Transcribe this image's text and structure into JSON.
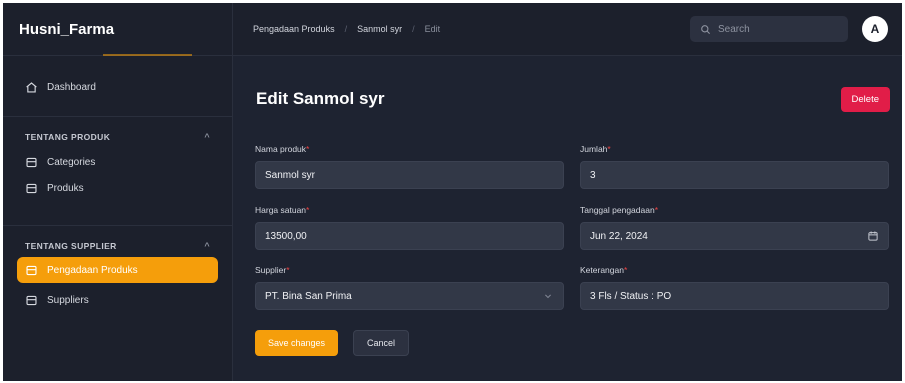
{
  "app": {
    "title": "Husni_Farma"
  },
  "sidebar": {
    "dashboard": "Dashboard",
    "groups": [
      {
        "label": "TENTANG PRODUK",
        "items": [
          "Categories",
          "Produks"
        ]
      },
      {
        "label": "TENTANG SUPPLIER",
        "items": [
          "Pengadaan Produks",
          "Suppliers"
        ]
      }
    ],
    "active_item": "Pengadaan Produks"
  },
  "header": {
    "breadcrumb": [
      "Pengadaan Produks",
      "Sanmol syr",
      "Edit"
    ],
    "search_placeholder": "Search",
    "avatar_initial": "A"
  },
  "page": {
    "title": "Edit Sanmol syr",
    "delete_label": "Delete",
    "required_mark": "*",
    "fields": {
      "nama_produk": {
        "label": "Nama produk",
        "value": "Sanmol syr"
      },
      "jumlah": {
        "label": "Jumlah",
        "value": "3"
      },
      "harga_satuan": {
        "label": "Harga satuan",
        "value": "13500,00"
      },
      "tanggal_pengadaan": {
        "label": "Tanggal pengadaan",
        "value": "Jun 22, 2024"
      },
      "supplier": {
        "label": "Supplier",
        "value": "PT. Bina San Prima"
      },
      "keterangan": {
        "label": "Keterangan",
        "value": "3 Fls / Status : PO"
      }
    },
    "save_label": "Save changes",
    "cancel_label": "Cancel"
  },
  "colors": {
    "accent": "#f59e0b",
    "danger": "#e11d48",
    "background": "#1e2331"
  }
}
